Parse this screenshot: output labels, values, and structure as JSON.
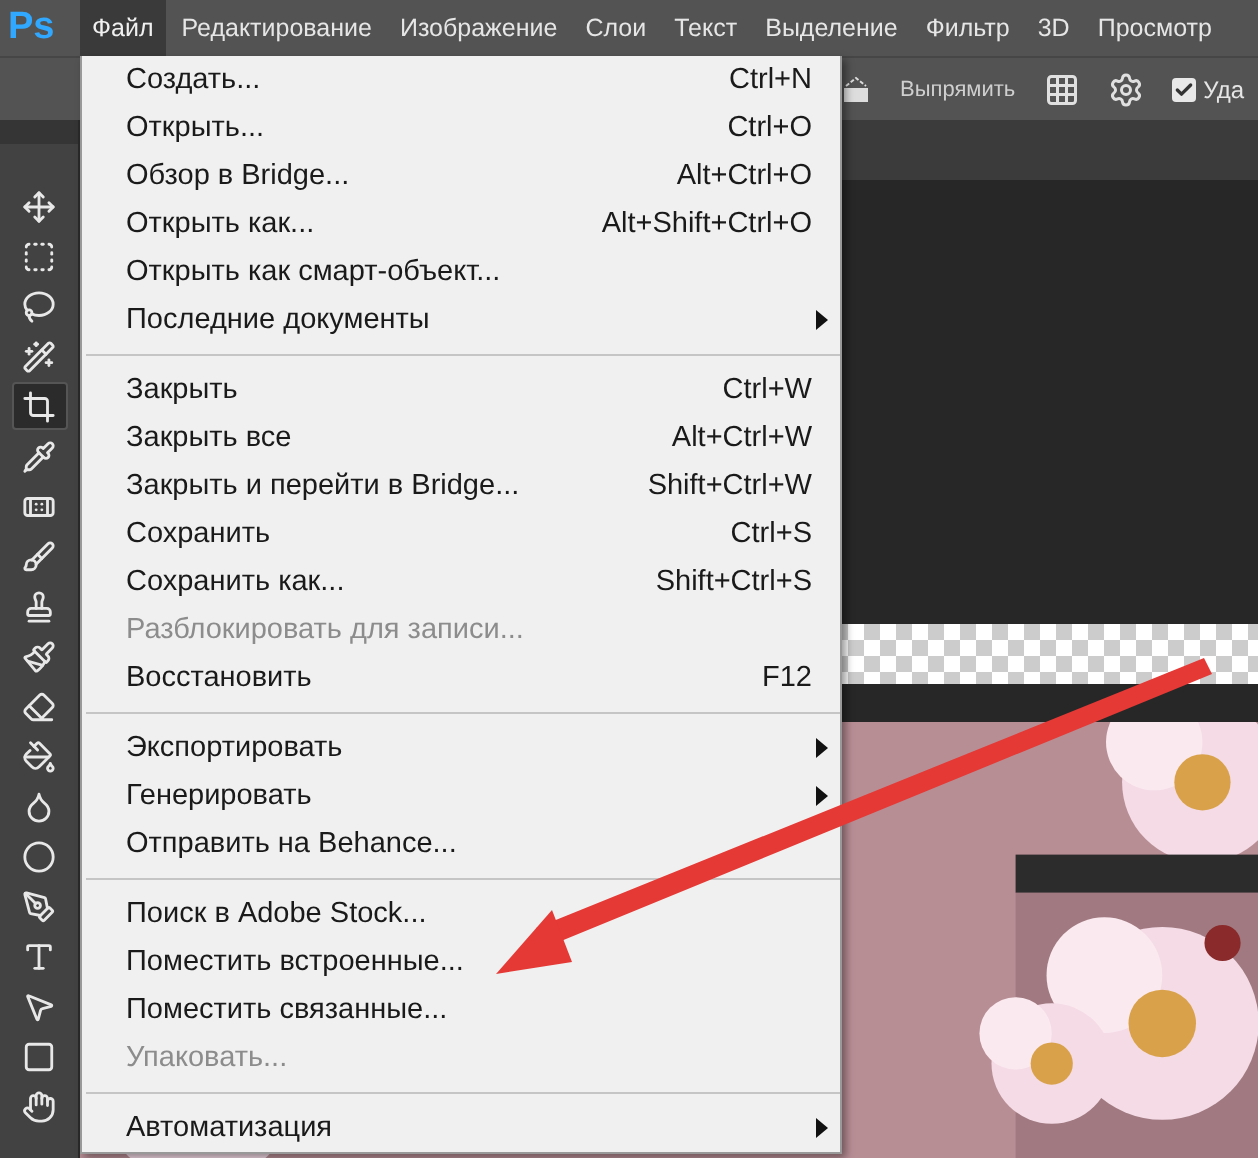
{
  "app_logo": "Ps",
  "menu_bar": [
    {
      "label": "Файл",
      "selected": true
    },
    {
      "label": "Редактирование",
      "selected": false
    },
    {
      "label": "Изображение",
      "selected": false
    },
    {
      "label": "Слои",
      "selected": false
    },
    {
      "label": "Текст",
      "selected": false
    },
    {
      "label": "Выделение",
      "selected": false
    },
    {
      "label": "Фильтр",
      "selected": false
    },
    {
      "label": "3D",
      "selected": false
    },
    {
      "label": "Просмотр",
      "selected": false
    }
  ],
  "options_bar": {
    "straighten_label": "Выпрямить",
    "delete_checkbox": {
      "label": "Уда",
      "checked": true
    }
  },
  "tools": [
    {
      "kind": "move",
      "selected": false
    },
    {
      "kind": "marquee",
      "selected": false
    },
    {
      "kind": "lasso",
      "selected": false
    },
    {
      "kind": "wand",
      "selected": false
    },
    {
      "kind": "crop",
      "selected": true
    },
    {
      "kind": "eyedropper",
      "selected": false
    },
    {
      "kind": "healing",
      "selected": false
    },
    {
      "kind": "brush",
      "selected": false
    },
    {
      "kind": "stamp",
      "selected": false
    },
    {
      "kind": "history",
      "selected": false
    },
    {
      "kind": "eraser",
      "selected": false
    },
    {
      "kind": "bucket",
      "selected": false
    },
    {
      "kind": "blur",
      "selected": false
    },
    {
      "kind": "dodge",
      "selected": false
    },
    {
      "kind": "pen",
      "selected": false
    },
    {
      "kind": "type",
      "selected": false
    },
    {
      "kind": "select",
      "selected": false
    },
    {
      "kind": "shape",
      "selected": false
    },
    {
      "kind": "hand",
      "selected": false
    }
  ],
  "file_menu": [
    [
      {
        "label": "Создать...",
        "shortcut": "Ctrl+N",
        "submenu": false,
        "disabled": false
      },
      {
        "label": "Открыть...",
        "shortcut": "Ctrl+O",
        "submenu": false,
        "disabled": false
      },
      {
        "label": "Обзор в Bridge...",
        "shortcut": "Alt+Ctrl+O",
        "submenu": false,
        "disabled": false
      },
      {
        "label": "Открыть как...",
        "shortcut": "Alt+Shift+Ctrl+O",
        "submenu": false,
        "disabled": false
      },
      {
        "label": "Открыть как смарт-объект...",
        "submenu": false,
        "disabled": false
      },
      {
        "label": "Последние документы",
        "submenu": true,
        "disabled": false
      }
    ],
    [
      {
        "label": "Закрыть",
        "shortcut": "Ctrl+W",
        "submenu": false,
        "disabled": false
      },
      {
        "label": "Закрыть все",
        "shortcut": "Alt+Ctrl+W",
        "submenu": false,
        "disabled": false
      },
      {
        "label": "Закрыть и перейти в Bridge...",
        "shortcut": "Shift+Ctrl+W",
        "submenu": false,
        "disabled": false
      },
      {
        "label": "Сохранить",
        "shortcut": "Ctrl+S",
        "submenu": false,
        "disabled": false
      },
      {
        "label": "Сохранить как...",
        "shortcut": "Shift+Ctrl+S",
        "submenu": false,
        "disabled": false
      },
      {
        "label": "Разблокировать для записи...",
        "submenu": false,
        "disabled": true
      },
      {
        "label": "Восстановить",
        "shortcut": "F12",
        "submenu": false,
        "disabled": false
      }
    ],
    [
      {
        "label": "Экспортировать",
        "submenu": true,
        "disabled": false
      },
      {
        "label": "Генерировать",
        "submenu": true,
        "disabled": false
      },
      {
        "label": "Отправить на Behance...",
        "submenu": false,
        "disabled": false
      }
    ],
    [
      {
        "label": "Поиск в Adobe Stock...",
        "submenu": false,
        "disabled": false
      },
      {
        "label": "Поместить встроенные...",
        "submenu": false,
        "disabled": false
      },
      {
        "label": "Поместить связанные...",
        "submenu": false,
        "disabled": false
      },
      {
        "label": "Упаковать...",
        "submenu": false,
        "disabled": true
      }
    ],
    [
      {
        "label": "Автоматизация",
        "submenu": true,
        "disabled": false
      }
    ]
  ]
}
